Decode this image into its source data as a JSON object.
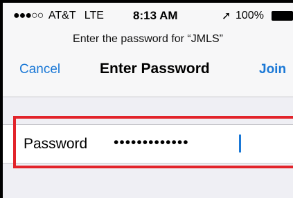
{
  "status_bar": {
    "signal": "●●●○○",
    "carrier": "AT&T",
    "network": "LTE",
    "time": "8:13 AM",
    "location_glyph": "➚",
    "battery": "100%"
  },
  "prompt": "Enter the password for “JMLS”",
  "nav": {
    "cancel_label": "Cancel",
    "title": "Enter Password",
    "join_label": "Join"
  },
  "password_field": {
    "label": "Password",
    "value": "•••••••••••••"
  },
  "colors": {
    "accent": "#1a78d6",
    "highlight": "#e2232a"
  }
}
